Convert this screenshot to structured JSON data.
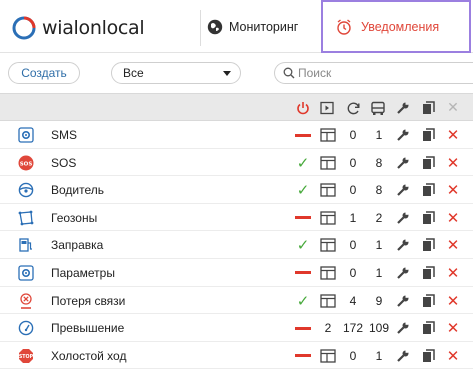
{
  "app": {
    "logo_text": "wialonlocal",
    "nav_monitoring": "Мониторинг",
    "nav_notifications": "Уведомления"
  },
  "toolbar": {
    "create_label": "Создать",
    "filter_selected": "Все",
    "search_placeholder": "Поиск"
  },
  "columns": [
    "state-icon",
    "type-icon",
    "refresh-icon",
    "vehicle-icon",
    "wrench-icon",
    "copy-icon",
    "close-icon"
  ],
  "colors": {
    "accent": "#2f6ea8",
    "active_tab_border": "#9b7fe0",
    "notif_text": "#e0473a",
    "on": "#47a93b",
    "off": "#e0382b"
  },
  "rows": [
    {
      "name": "SMS",
      "icon": "sms-icon",
      "enabled": false,
      "type": "window",
      "n1": "0",
      "n2": "1"
    },
    {
      "name": "SOS",
      "icon": "sos-icon",
      "enabled": true,
      "type": "window",
      "n1": "0",
      "n2": "8"
    },
    {
      "name": "Водитель",
      "icon": "driver-icon",
      "enabled": true,
      "type": "window",
      "n1": "0",
      "n2": "8"
    },
    {
      "name": "Геозоны",
      "icon": "geofence-icon",
      "enabled": false,
      "type": "window",
      "n1": "1",
      "n2": "2"
    },
    {
      "name": "Заправка",
      "icon": "fuel-icon",
      "enabled": true,
      "type": "window",
      "n1": "0",
      "n2": "1"
    },
    {
      "name": "Параметры",
      "icon": "parameters-icon",
      "enabled": false,
      "type": "window",
      "n1": "0",
      "n2": "1"
    },
    {
      "name": "Потеря связи",
      "icon": "connection-loss-icon",
      "enabled": true,
      "type": "window",
      "n1": "4",
      "n2": "9"
    },
    {
      "name": "Превышение",
      "icon": "speeding-icon",
      "enabled": false,
      "type": "number",
      "type_value": "2",
      "n1": "172",
      "n2": "109"
    },
    {
      "name": "Холостой ход",
      "icon": "idling-icon",
      "enabled": false,
      "type": "window",
      "n1": "0",
      "n2": "1"
    }
  ]
}
